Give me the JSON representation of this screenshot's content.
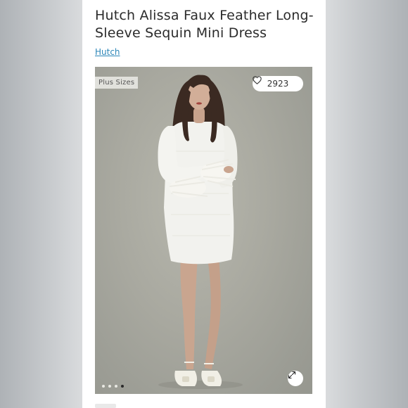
{
  "listing": {
    "title": "Hutch Alissa Faux Feather Long-Sleeve Sequin Mini Dress",
    "brand": "Hutch"
  },
  "photo": {
    "size_chip": "Plus Sizes",
    "like_count": "2923",
    "like_icon": "heart-outline-icon",
    "expand_icon": "expand-arrows-icon",
    "carousel": {
      "total": 4,
      "active": 4
    }
  },
  "colors": {
    "brand_link": "#2c86b8",
    "backdrop": "#a9a9a0",
    "dress": "#f2f2ee"
  }
}
